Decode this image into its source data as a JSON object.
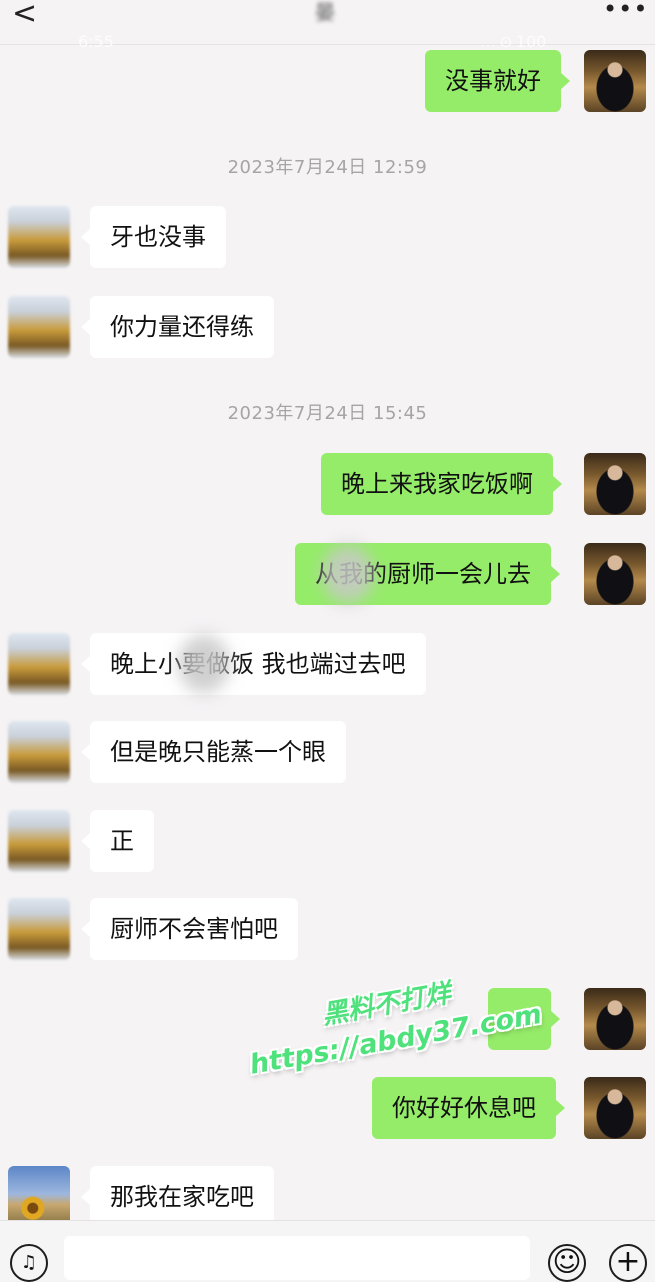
{
  "header": {
    "back_glyph": "<",
    "title": "晏",
    "more_glyph": "•••",
    "status_time": "6:55",
    "status_battery": "… ⊙ 100"
  },
  "timestamps": [
    "2023年7月24日 12:59",
    "2023年7月24日 15:45"
  ],
  "messages": [
    {
      "side": "out",
      "text": "没事就好"
    },
    {
      "side": "in",
      "text": "牙也没事"
    },
    {
      "side": "in",
      "text": "你力量还得练"
    },
    {
      "side": "out",
      "text": "晚上来我家吃饭啊"
    },
    {
      "side": "out",
      "text": "从我的厨师一会儿去"
    },
    {
      "side": "in",
      "text": "晚上小要做饭 我也端过去吧"
    },
    {
      "side": "in",
      "text": "但是晚只能蒸一个眼"
    },
    {
      "side": "in",
      "text": "正"
    },
    {
      "side": "in",
      "text": "厨师不会害怕吧"
    },
    {
      "side": "out",
      "text": "..."
    },
    {
      "side": "out",
      "text": "你好好休息吧"
    },
    {
      "side": "in",
      "text": "那我在家吃吧"
    }
  ],
  "watermark": {
    "line1": "黑料不打烊",
    "line2": "https://abdy37.com"
  },
  "input_bar": {
    "voice_icon": "voice-icon",
    "voice_glyph": "♫",
    "emoji_glyph": "☺",
    "plus_glyph": "+"
  },
  "colors": {
    "outgoing_bubble": "#95ec69",
    "incoming_bubble": "#ffffff",
    "background": "#f5f3f4",
    "timestamp_text": "#a6a4a5",
    "watermark": "#4fe27c"
  }
}
